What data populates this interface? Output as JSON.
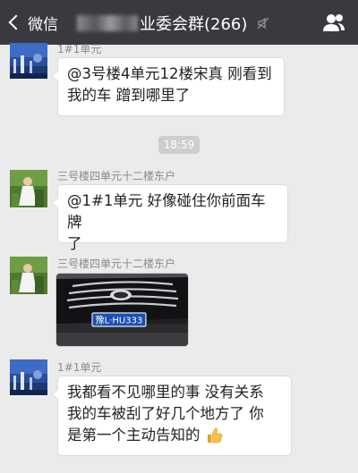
{
  "header": {
    "back_label": "微信",
    "title": "业委会群(266)",
    "icons": [
      "back-chevron-icon",
      "mute-icon",
      "group-members-icon"
    ]
  },
  "messages": [
    {
      "sender": "1#1单元",
      "text_lines": [
        "@3号楼4单元12楼宋真 刚看到",
        "我的车  蹭到哪里了"
      ]
    },
    {
      "sender": "三号楼四单元十二楼东户",
      "text_lines": [
        "@1#1单元  好像碰住你前面车牌",
        "了"
      ]
    },
    {
      "sender": "三号楼四单元十二楼东户",
      "image": {
        "plate": "豫L·HU333"
      }
    },
    {
      "sender": "1#1单元",
      "text_lines": [
        "我都看不见哪里的事 没有关系",
        "我的车被刮了好几个地方了  你",
        "是第一个主动告知的"
      ],
      "emoji": "thumbs-up-icon"
    }
  ],
  "timestamp": "18:59"
}
